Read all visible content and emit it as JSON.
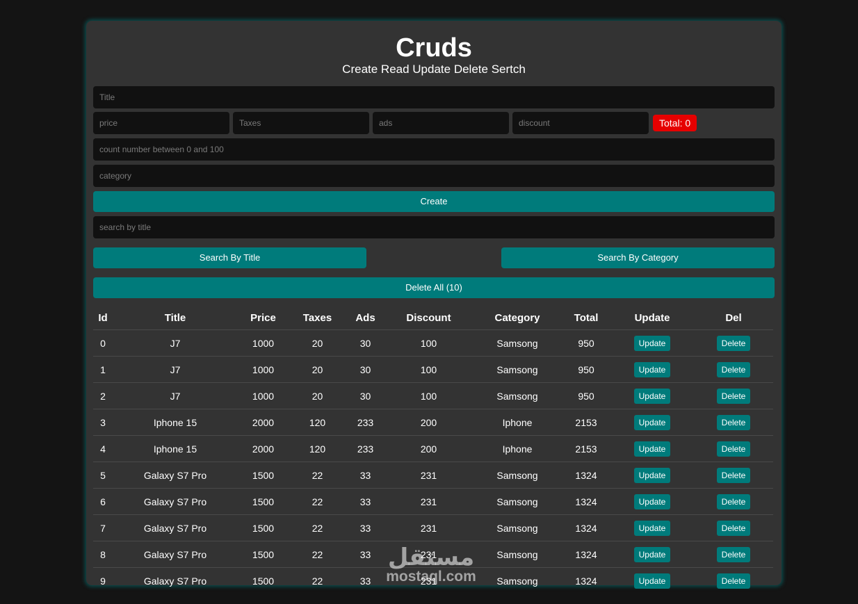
{
  "header": {
    "title": "Cruds",
    "subtitle": "Create Read Update Delete Sertch"
  },
  "form": {
    "title_placeholder": "Title",
    "price_placeholder": "price",
    "taxes_placeholder": "Taxes",
    "ads_placeholder": "ads",
    "discount_placeholder": "discount",
    "total_label": "Total: 0",
    "count_placeholder": "count number between 0 and 100",
    "category_placeholder": "category",
    "create_label": "Create",
    "search_placeholder": "search by title",
    "search_title_label": "Search By Title",
    "search_category_label": "Search By Category",
    "delete_all_label": "Delete All (10)"
  },
  "table": {
    "headers": [
      "Id",
      "Title",
      "Price",
      "Taxes",
      "Ads",
      "Discount",
      "Category",
      "Total",
      "Update",
      "Del"
    ],
    "update_label": "Update",
    "delete_label": "Delete",
    "rows": [
      [
        "0",
        "J7",
        "1000",
        "20",
        "30",
        "100",
        "Samsong",
        "950"
      ],
      [
        "1",
        "J7",
        "1000",
        "20",
        "30",
        "100",
        "Samsong",
        "950"
      ],
      [
        "2",
        "J7",
        "1000",
        "20",
        "30",
        "100",
        "Samsong",
        "950"
      ],
      [
        "3",
        "Iphone 15",
        "2000",
        "120",
        "233",
        "200",
        "Iphone",
        "2153"
      ],
      [
        "4",
        "Iphone 15",
        "2000",
        "120",
        "233",
        "200",
        "Iphone",
        "2153"
      ],
      [
        "5",
        "Galaxy S7 Pro",
        "1500",
        "22",
        "33",
        "231",
        "Samsong",
        "1324"
      ],
      [
        "6",
        "Galaxy S7 Pro",
        "1500",
        "22",
        "33",
        "231",
        "Samsong",
        "1324"
      ],
      [
        "7",
        "Galaxy S7 Pro",
        "1500",
        "22",
        "33",
        "231",
        "Samsong",
        "1324"
      ],
      [
        "8",
        "Galaxy S7 Pro",
        "1500",
        "22",
        "33",
        "231",
        "Samsong",
        "1324"
      ],
      [
        "9",
        "Galaxy S7 Pro",
        "1500",
        "22",
        "33",
        "231",
        "Samsong",
        "1324"
      ]
    ]
  },
  "watermark": {
    "arabic": "مستقل",
    "latin": "mostaql.com"
  },
  "colors": {
    "background": "#141414",
    "panel": "#333333",
    "input": "#111111",
    "accent": "#007b7b",
    "total_badge": "#e60000"
  }
}
